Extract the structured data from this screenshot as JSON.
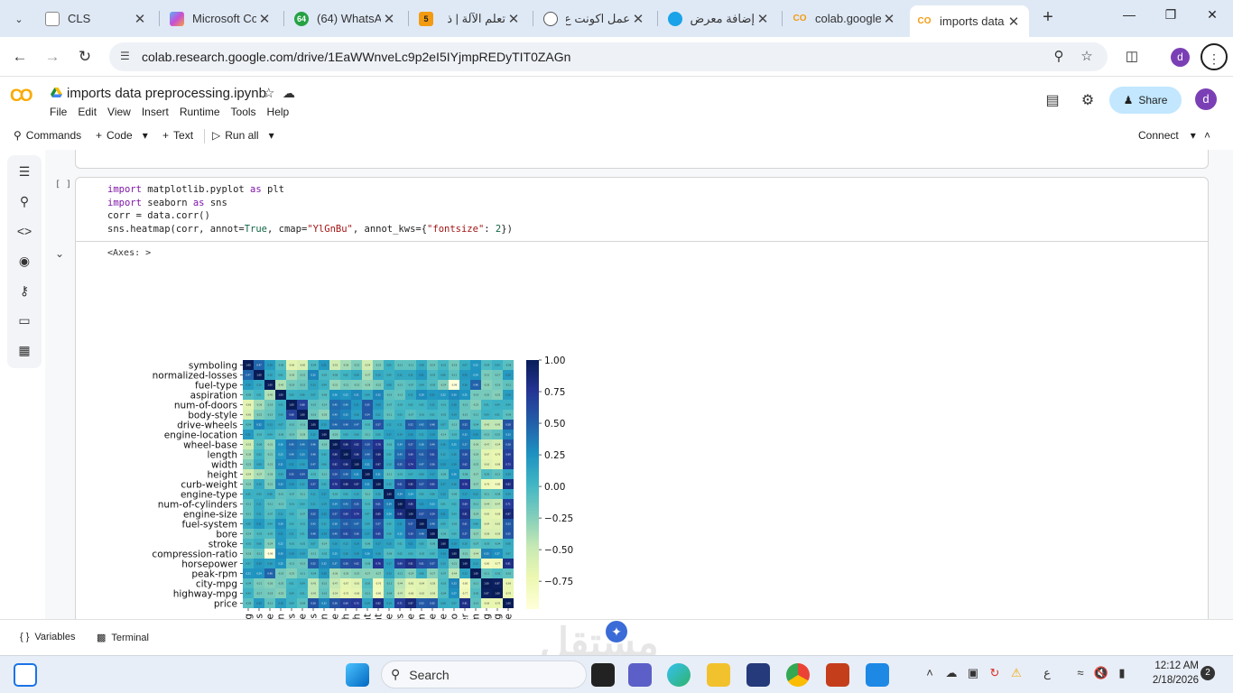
{
  "browser": {
    "tabs": [
      {
        "label": "CLS",
        "icon": "globe-icon"
      },
      {
        "label": "Microsoft Co",
        "icon": "copilot-icon"
      },
      {
        "label": "(64) WhatsAp",
        "icon": "whatsapp-icon",
        "badge": "64"
      },
      {
        "label": "تعلم الآلة | ذ",
        "icon": "site-icon",
        "badge": "5"
      },
      {
        "label": "عمل اكونت ع",
        "icon": "chatgpt-icon"
      },
      {
        "label": "إضافة معرض",
        "icon": "circle-icon"
      },
      {
        "label": "colab.google",
        "icon": "colab-icon"
      },
      {
        "label": "imports data",
        "icon": "colab-icon",
        "active": true
      }
    ],
    "url": "colab.research.google.com/drive/1EaWWnveLc9p2eI5IYjmpREDyTIT0ZAGn",
    "profile_letter": "d"
  },
  "colab": {
    "logo": "CO",
    "notebook_title": "imports data preprocessing.ipynb",
    "menu": [
      "File",
      "Edit",
      "View",
      "Insert",
      "Runtime",
      "Tools",
      "Help"
    ],
    "share_label": "Share",
    "avatar_letter": "d",
    "toolbar": {
      "commands": "Commands",
      "code": "Code",
      "text": "Text",
      "run_all": "Run all",
      "connect": "Connect"
    },
    "cell": {
      "bracket": "[ ]",
      "code": [
        "import matplotlib.pyplot as plt",
        "import seaborn as sns",
        "corr = data.corr()",
        "sns.heatmap(corr, annot=True, cmap=\"YlGnBu\", annot_kws={\"fontsize\": 2})"
      ],
      "output_text": "<Axes: >"
    },
    "bottom": {
      "variables": "Variables",
      "terminal": "Terminal",
      "watermark": "مستقل"
    }
  },
  "taskbar": {
    "search_placeholder": "Search",
    "time": "12:12 AM",
    "date": "2/18/2026",
    "notifications": "2",
    "lang": "ع"
  },
  "chart_data": {
    "type": "heatmap",
    "title": "",
    "xlabel": "",
    "ylabel": "",
    "cmap": "YlGnBu",
    "labels": [
      "symboling",
      "normalized-losses",
      "fuel-type",
      "aspiration",
      "num-of-doors",
      "body-style",
      "drive-wheels",
      "engine-location",
      "wheel-base",
      "length",
      "width",
      "height",
      "curb-weight",
      "engine-type",
      "num-of-cylinders",
      "engine-size",
      "fuel-system",
      "bore",
      "stroke",
      "compression-ratio",
      "horsepower",
      "peak-rpm",
      "city-mpg",
      "highway-mpg",
      "price"
    ],
    "colorbar_ticks": [
      1.0,
      0.75,
      0.5,
      0.25,
      0.0,
      -0.25,
      -0.5,
      -0.75
    ],
    "colorbar_tick_labels": [
      "1.00",
      "0.75",
      "0.50",
      "0.25",
      "0.00",
      "−0.25",
      "−0.50",
      "−0.75"
    ],
    "vmin": -0.97,
    "vmax": 1.0,
    "values": [
      [
        1.0,
        0.47,
        0.19,
        -0.06,
        -0.66,
        -0.6,
        -0.04,
        0.21,
        -0.53,
        -0.36,
        -0.23,
        -0.54,
        -0.23,
        0.05,
        -0.11,
        -0.11,
        0.08,
        -0.14,
        -0.01,
        -0.18,
        0.07,
        0.23,
        -0.04,
        0.04,
        -0.08
      ],
      [
        0.47,
        1.0,
        0.1,
        0.01,
        -0.36,
        -0.22,
        0.32,
        -0.02,
        -0.06,
        0.02,
        0.09,
        -0.37,
        0.1,
        0.05,
        0.11,
        0.11,
        0.21,
        -0.03,
        0.06,
        -0.11,
        0.2,
        0.24,
        -0.21,
        -0.17,
        0.2
      ],
      [
        0.19,
        0.1,
        1.0,
        -0.4,
        -0.19,
        -0.15,
        0.13,
        0.04,
        -0.31,
        -0.21,
        -0.23,
        -0.28,
        -0.22,
        0.08,
        -0.11,
        -0.07,
        0.04,
        -0.05,
        -0.24,
        -0.98,
        0.16,
        0.48,
        -0.26,
        -0.19,
        -0.11
      ],
      [
        -0.06,
        0.01,
        -0.4,
        1.0,
        0.05,
        0.06,
        0.07,
        -0.06,
        0.26,
        0.23,
        0.31,
        0.09,
        0.32,
        -0.1,
        -0.13,
        0.11,
        0.29,
        0.21,
        0.22,
        0.3,
        0.25,
        -0.19,
        -0.2,
        -0.25,
        0.18
      ],
      [
        -0.66,
        -0.36,
        -0.19,
        0.05,
        1.0,
        0.68,
        -0.1,
        -0.14,
        0.45,
        0.4,
        0.21,
        0.55,
        0.2,
        -0.07,
        -0.01,
        0.02,
        0.02,
        0.11,
        -0.01,
        0.18,
        -0.13,
        -0.25,
        0.01,
        0.04,
        0.04
      ],
      [
        -0.6,
        -0.22,
        -0.15,
        0.06,
        0.68,
        1.0,
        -0.16,
        -0.28,
        0.4,
        0.33,
        0.16,
        0.54,
        0.12,
        -0.11,
        0.03,
        -0.07,
        -0.01,
        0.01,
        -0.02,
        0.14,
        -0.15,
        -0.11,
        0.04,
        0.01,
        -0.09
      ],
      [
        -0.04,
        0.32,
        0.13,
        0.07,
        -0.1,
        -0.16,
        1.0,
        0.15,
        0.46,
        0.48,
        0.47,
        -0.02,
        0.57,
        0.11,
        0.11,
        0.52,
        0.42,
        0.48,
        0.07,
        -0.13,
        0.52,
        -0.04,
        -0.45,
        -0.45,
        0.58
      ],
      [
        0.21,
        -0.02,
        0.04,
        -0.06,
        -0.14,
        -0.28,
        0.15,
        1.0,
        -0.19,
        0.05,
        0.06,
        -0.11,
        0.05,
        0.17,
        0.14,
        0.2,
        0.11,
        0.19,
        -0.14,
        -0.02,
        0.32,
        0.2,
        -0.15,
        -0.1,
        0.33
      ],
      [
        -0.53,
        -0.06,
        -0.31,
        0.26,
        0.45,
        0.4,
        0.46,
        -0.19,
        1.0,
        0.88,
        0.82,
        0.59,
        0.78,
        -0.02,
        0.34,
        0.57,
        0.38,
        0.49,
        0.16,
        0.25,
        0.37,
        -0.36,
        -0.47,
        -0.54,
        0.58
      ],
      [
        -0.36,
        0.02,
        -0.21,
        0.23,
        0.4,
        0.33,
        0.48,
        0.05,
        0.88,
        1.0,
        0.86,
        0.49,
        0.88,
        0.05,
        0.43,
        0.69,
        0.51,
        0.61,
        0.12,
        0.16,
        0.58,
        -0.29,
        -0.67,
        -0.7,
        0.69
      ],
      [
        -0.23,
        0.09,
        -0.23,
        0.31,
        0.21,
        0.16,
        0.47,
        0.06,
        0.82,
        0.86,
        1.0,
        0.31,
        0.87,
        0.1,
        0.55,
        0.74,
        0.47,
        0.56,
        0.19,
        0.19,
        0.62,
        -0.25,
        -0.63,
        -0.68,
        0.73
      ],
      [
        -0.54,
        -0.37,
        -0.28,
        0.09,
        0.55,
        0.54,
        -0.02,
        -0.11,
        0.59,
        0.49,
        0.31,
        1.0,
        0.31,
        -0.11,
        -0.01,
        0.07,
        0.09,
        0.17,
        -0.06,
        0.26,
        -0.08,
        -0.27,
        -0.05,
        -0.11,
        0.14
      ],
      [
        -0.23,
        0.1,
        -0.22,
        0.32,
        0.2,
        0.12,
        0.57,
        0.05,
        0.78,
        0.88,
        0.87,
        0.31,
        1.0,
        0.1,
        0.61,
        0.85,
        0.57,
        0.65,
        0.17,
        0.16,
        0.76,
        -0.27,
        -0.76,
        -0.8,
        0.82
      ],
      [
        0.05,
        0.05,
        0.08,
        -0.1,
        -0.07,
        -0.11,
        0.11,
        0.17,
        -0.02,
        0.05,
        0.1,
        -0.11,
        0.1,
        1.0,
        0.34,
        0.24,
        0.05,
        0.06,
        0.15,
        -0.06,
        0.17,
        0.13,
        -0.11,
        -0.09,
        0.14
      ],
      [
        -0.11,
        0.11,
        -0.11,
        -0.13,
        -0.01,
        0.03,
        0.11,
        0.14,
        0.34,
        0.43,
        0.55,
        -0.01,
        0.61,
        0.34,
        1.0,
        0.85,
        0.21,
        0.23,
        0.01,
        0.02,
        0.69,
        -0.11,
        -0.44,
        -0.47,
        0.71
      ],
      [
        -0.11,
        0.11,
        -0.07,
        0.11,
        0.02,
        -0.07,
        0.52,
        0.2,
        0.57,
        0.69,
        0.74,
        0.07,
        0.85,
        0.24,
        0.85,
        1.0,
        0.57,
        0.59,
        0.21,
        0.03,
        0.81,
        -0.24,
        -0.65,
        -0.68,
        0.87
      ],
      [
        0.08,
        0.21,
        0.04,
        0.29,
        0.02,
        -0.01,
        0.42,
        0.11,
        0.38,
        0.51,
        0.47,
        0.09,
        0.57,
        0.05,
        0.21,
        0.57,
        1.0,
        0.48,
        0.05,
        -0.02,
        0.61,
        0.06,
        -0.64,
        -0.62,
        0.53
      ],
      [
        -0.14,
        -0.03,
        -0.05,
        0.21,
        0.11,
        0.01,
        0.48,
        0.19,
        0.49,
        0.61,
        0.56,
        0.17,
        0.65,
        0.06,
        0.23,
        0.59,
        0.48,
        1.0,
        -0.06,
        0.0,
        0.57,
        -0.27,
        -0.58,
        -0.59,
        0.55
      ],
      [
        -0.01,
        0.06,
        -0.24,
        0.22,
        -0.01,
        -0.02,
        0.07,
        -0.14,
        0.16,
        0.12,
        0.19,
        -0.06,
        0.17,
        0.15,
        0.01,
        0.21,
        0.05,
        -0.06,
        1.0,
        0.19,
        0.1,
        -0.07,
        -0.03,
        -0.04,
        0.08
      ],
      [
        -0.18,
        -0.11,
        -0.98,
        0.3,
        0.18,
        0.14,
        -0.13,
        -0.02,
        0.25,
        0.16,
        0.19,
        0.26,
        0.16,
        -0.06,
        0.02,
        0.03,
        -0.02,
        0.0,
        0.19,
        1.0,
        -0.21,
        -0.44,
        0.33,
        0.27,
        0.07
      ],
      [
        0.07,
        0.2,
        0.16,
        0.25,
        -0.13,
        -0.15,
        0.52,
        0.32,
        0.37,
        0.58,
        0.62,
        -0.08,
        0.76,
        0.17,
        0.69,
        0.81,
        0.61,
        0.57,
        0.1,
        -0.21,
        1.0,
        0.13,
        -0.8,
        -0.77,
        0.81
      ],
      [
        0.23,
        0.24,
        0.48,
        -0.19,
        -0.25,
        -0.11,
        -0.04,
        0.2,
        -0.36,
        -0.29,
        -0.25,
        -0.27,
        -0.27,
        0.13,
        -0.11,
        -0.24,
        0.06,
        -0.27,
        -0.07,
        -0.44,
        0.13,
        1.0,
        -0.11,
        -0.05,
        -0.1
      ],
      [
        -0.04,
        -0.21,
        -0.26,
        -0.2,
        0.01,
        0.04,
        -0.45,
        -0.15,
        -0.47,
        -0.67,
        -0.63,
        -0.05,
        -0.76,
        -0.11,
        -0.44,
        -0.65,
        -0.64,
        -0.58,
        -0.03,
        0.33,
        -0.8,
        -0.11,
        1.0,
        0.97,
        -0.69
      ],
      [
        0.04,
        -0.17,
        -0.19,
        -0.25,
        0.04,
        0.01,
        -0.45,
        -0.1,
        -0.54,
        -0.7,
        -0.68,
        -0.11,
        -0.8,
        -0.09,
        -0.47,
        -0.68,
        -0.62,
        -0.59,
        -0.04,
        0.27,
        -0.77,
        -0.05,
        0.97,
        1.0,
        -0.7
      ],
      [
        -0.08,
        0.2,
        -0.11,
        0.18,
        0.04,
        -0.09,
        0.58,
        0.33,
        0.58,
        0.69,
        0.73,
        0.14,
        0.82,
        0.14,
        0.71,
        0.87,
        0.53,
        0.55,
        0.08,
        0.07,
        0.81,
        -0.1,
        -0.69,
        -0.7,
        1.0
      ]
    ]
  }
}
